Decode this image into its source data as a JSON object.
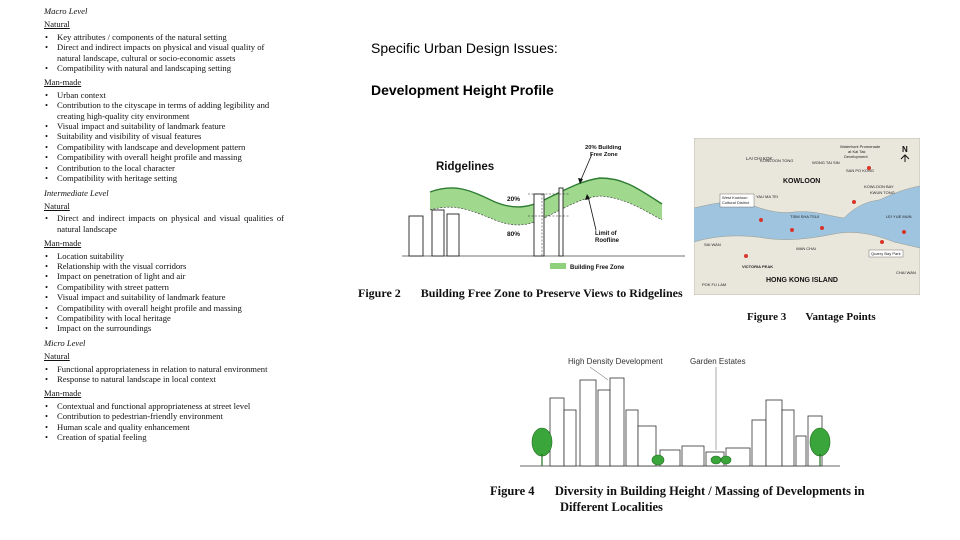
{
  "left_column": {
    "macro": {
      "title": "Macro Level",
      "natural": {
        "title": "Natural",
        "items": [
          "Key attributes / components of the natural setting",
          "Direct and indirect impacts on physical and visual quality of natural landscape, cultural or socio-economic assets",
          "Compatibility with natural and landscaping setting"
        ]
      },
      "manmade": {
        "title": "Man-made",
        "items": [
          "Urban context",
          "Contribution to the cityscape in terms of adding legibility and creating high-quality city environment",
          "Visual impact and suitability of landmark feature",
          "Suitability and visibility of visual features",
          "Compatibility with landscape and development pattern",
          "Compatibility with overall height profile and massing",
          "Contribution to the local character",
          "Compatibility with heritage setting"
        ]
      }
    },
    "intermediate": {
      "title": "Intermediate Level",
      "natural": {
        "title": "Natural",
        "items": [
          "Direct and indirect impacts on physical and visual qualities of natural landscape"
        ]
      },
      "manmade": {
        "title": "Man-made",
        "items": [
          "Location suitability",
          "Relationship with the visual corridors",
          "Impact on penetration of light and air",
          "Compatibility with street pattern",
          "Visual impact and suitability of landmark feature",
          "Compatibility with overall height profile and massing",
          "Compatibility with local heritage",
          "Impact on the surroundings"
        ]
      }
    },
    "micro": {
      "title": "Micro Level",
      "natural": {
        "title": "Natural",
        "items": [
          "Functional appropriateness in relation to natural environment",
          "Response to natural landscape in local context"
        ]
      },
      "manmade": {
        "title": "Man-made",
        "items": [
          "Contextual and functional appropriateness at street level",
          "Contribution to pedestrian-friendly environment",
          "Human scale and quality enhancement",
          "Creation of spatial feeling"
        ]
      }
    }
  },
  "headings": {
    "issues": "Specific Urban Design Issues:",
    "profile": "Development Height Profile"
  },
  "figure2": {
    "ridgelines": "Ridgelines",
    "bfz_top_line1": "20% Building",
    "bfz_top_line2": "Free Zone",
    "pct_20": "20%",
    "pct_80": "80%",
    "limit_line1": "Limit of",
    "limit_line2": "Roofline",
    "legend": "Building Free Zone",
    "caption_num": "Figure 2",
    "caption_text": "Building Free Zone to Preserve Views to Ridgelines"
  },
  "figure3": {
    "north": "N",
    "labels": {
      "lai_chi_kok": "LAI CHI KOK",
      "kowloon_tong": "KOWLOON TONG",
      "waterfront": "Waterfront Promenade",
      "kai_tak_line2": "at Kai Tak",
      "development": "Development",
      "wong_tai_sin": "WONG TAI SIN",
      "san_po_kong": "SAN PO KONG",
      "kowloon": "KOWLOON",
      "kowloon_bay": "KOWLOON BAY",
      "kwun_tong": "KWUN TONG",
      "yau_ma_tei": "YAU MA TEI",
      "west_kowloon": "West Kowloon",
      "cultural_district": "Cultural District",
      "tsim_sha_tsui": "TSIM SHA TSUI",
      "lei_yue_mun": "LEI YUE MUN",
      "sai_wan": "SAI WAN",
      "wan_chai": "WAN CHAI",
      "quarry_bay": "Quarry Bay Park",
      "victoria_peak": "VICTORIA PEAK",
      "hong_kong_island": "HONG KONG ISLAND",
      "pok_fu_lam": "POK FU LAM",
      "chai_wan": "CHAI WAN"
    },
    "caption_num": "Figure 3",
    "caption_text": "Vantage Points"
  },
  "figure4": {
    "high_density": "High Density Development",
    "garden_estates": "Garden Estates",
    "caption_num": "Figure 4",
    "caption_line1": "Diversity in Building Height / Massing of Developments in",
    "caption_line2": "Different Localities"
  },
  "colors": {
    "tree_green": "#3aa53a",
    "ridge_green": "#7cc56a",
    "bfz_green": "#8fd17a",
    "water_blue": "#9fc4df",
    "land": "#e9e6dc",
    "vantage_red": "#d8342a"
  }
}
